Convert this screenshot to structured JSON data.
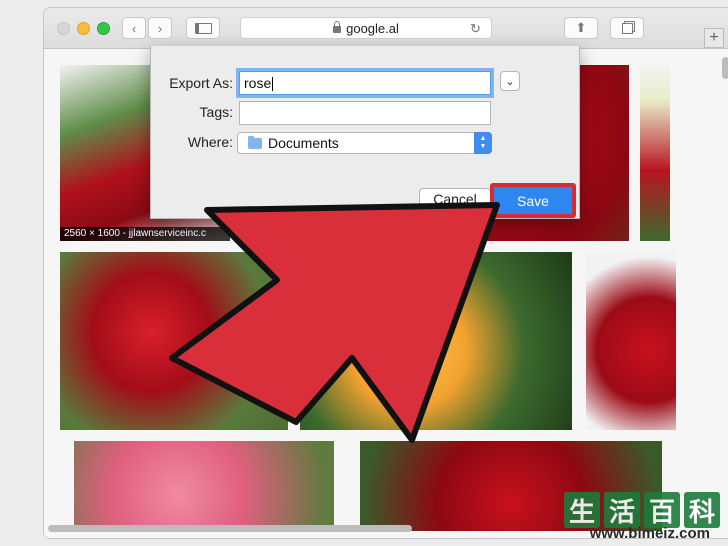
{
  "browser": {
    "address": "google.al",
    "back_icon": "chevron-left-icon",
    "forward_icon": "chevron-right-icon",
    "sidebar_icon": "sidebar-icon",
    "share_icon": "share-icon",
    "tabs_icon": "tabs-icon",
    "reload_icon": "reload-icon",
    "new_tab_label": "+"
  },
  "results": {
    "first_caption": "2560 × 1600 - jjlawnserviceinc.c"
  },
  "dialog": {
    "export_label": "Export As:",
    "export_value": "rose",
    "tags_label": "Tags:",
    "tags_value": "",
    "where_label": "Where:",
    "where_value": "Documents",
    "cancel_label": "Cancel",
    "save_label": "Save"
  },
  "watermark": {
    "chars": [
      "生",
      "活",
      "百",
      "科"
    ],
    "url": "www.bimeiz.com"
  },
  "colors": {
    "accent_blue": "#2e86ef",
    "highlight_red": "#d62c35",
    "arrow_red": "#d92f3b"
  }
}
